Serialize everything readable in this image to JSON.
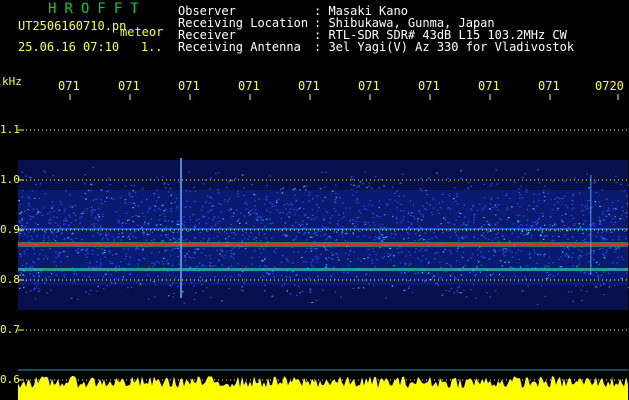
{
  "header": {
    "app_name": "HROFFT",
    "file_name": "UT2506160710.pn",
    "mode": "meteor",
    "datetime": "25.06.16 07:10",
    "extra": "1..",
    "info": [
      {
        "label": "Observer",
        "value": "Masaki Kano"
      },
      {
        "label": "Receiving Location",
        "value": "Shibukawa, Gunma, Japan"
      },
      {
        "label": "Receiver",
        "value": "RTL-SDR SDR# 43dB L15 103.2MHz CW"
      },
      {
        "label": "Receiving Antenna",
        "value": "3el Yagi(V) Az 330 for Vladivostok"
      }
    ]
  },
  "axes": {
    "frequency_unit": "kHz",
    "time_labels": [
      "071",
      "071",
      "071",
      "071",
      "071",
      "071",
      "071",
      "071",
      "071",
      "0720"
    ],
    "frequency_labels": [
      "1.1",
      "1.0",
      "0.9",
      "0.8",
      "0.7",
      "0.6"
    ]
  },
  "colors": {
    "background": "#000000",
    "label": "#ffff33",
    "title": "#00cc33",
    "info": "#ffffff",
    "tick": "#ffff33",
    "signal_line": "#ff2020",
    "noise": "#1030c0",
    "amplitude": "#ffff00"
  }
}
